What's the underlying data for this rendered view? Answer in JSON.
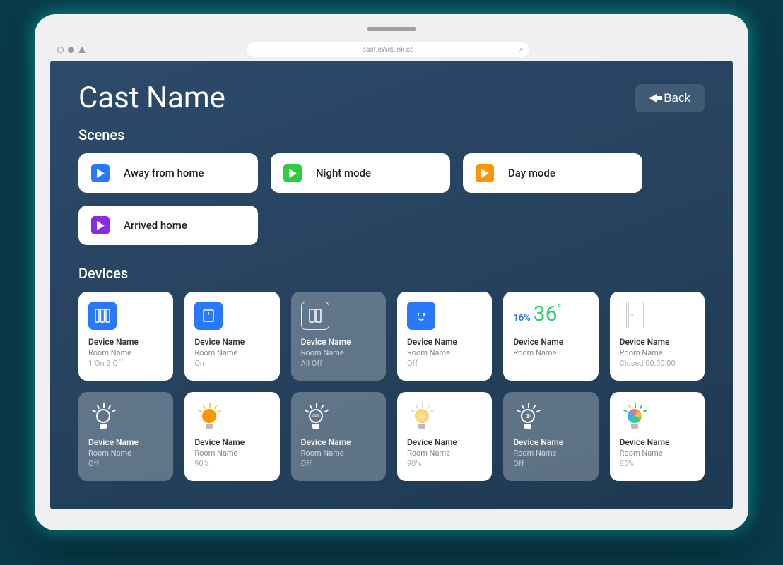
{
  "browser": {
    "url": "cast.eWeLink.cc"
  },
  "header": {
    "title": "Cast Name",
    "back_label": "Back"
  },
  "sections": {
    "scenes_title": "Scenes",
    "devices_title": "Devices"
  },
  "scenes": [
    {
      "label": "Away from home",
      "color": "#2979ff"
    },
    {
      "label": "Night mode",
      "color": "#2ecc40"
    },
    {
      "label": "Day mode",
      "color": "#ff9500"
    },
    {
      "label": "Arrived home",
      "color": "#8a2be2"
    }
  ],
  "devices": [
    {
      "name": "Device Name",
      "room": "Room Name",
      "status": "1 On 2 Off",
      "type": "multi-switch",
      "active": true
    },
    {
      "name": "Device Name",
      "room": "Room Name",
      "status": "On",
      "type": "switch",
      "active": true
    },
    {
      "name": "Device Name",
      "room": "Room Name",
      "status": "All Off",
      "type": "dual-switch",
      "active": false
    },
    {
      "name": "Device Name",
      "room": "Room Name",
      "status": "Off",
      "type": "socket",
      "active": true
    },
    {
      "name": "Device Name",
      "room": "Room Name",
      "status": "",
      "type": "temp",
      "humidity": "16%",
      "temperature": "36",
      "active": true
    },
    {
      "name": "Device Name",
      "room": "Room Name",
      "status": "Closed 00:00:00",
      "type": "door",
      "active": true
    },
    {
      "name": "Device Name",
      "room": "Room Name",
      "status": "Off",
      "type": "bulb-plain",
      "active": false
    },
    {
      "name": "Device Name",
      "room": "Room Name",
      "status": "90%",
      "type": "bulb-warm",
      "active": true
    },
    {
      "name": "Device Name",
      "room": "Room Name",
      "status": "Off",
      "type": "bulb-loop",
      "active": false
    },
    {
      "name": "Device Name",
      "room": "Room Name",
      "status": "90%",
      "type": "bulb-soft",
      "active": true
    },
    {
      "name": "Device Name",
      "room": "Room Name",
      "status": "Off",
      "type": "bulb-cool",
      "active": false
    },
    {
      "name": "Device Name",
      "room": "Room Name",
      "status": "85%",
      "type": "bulb-rgb",
      "active": true
    }
  ]
}
